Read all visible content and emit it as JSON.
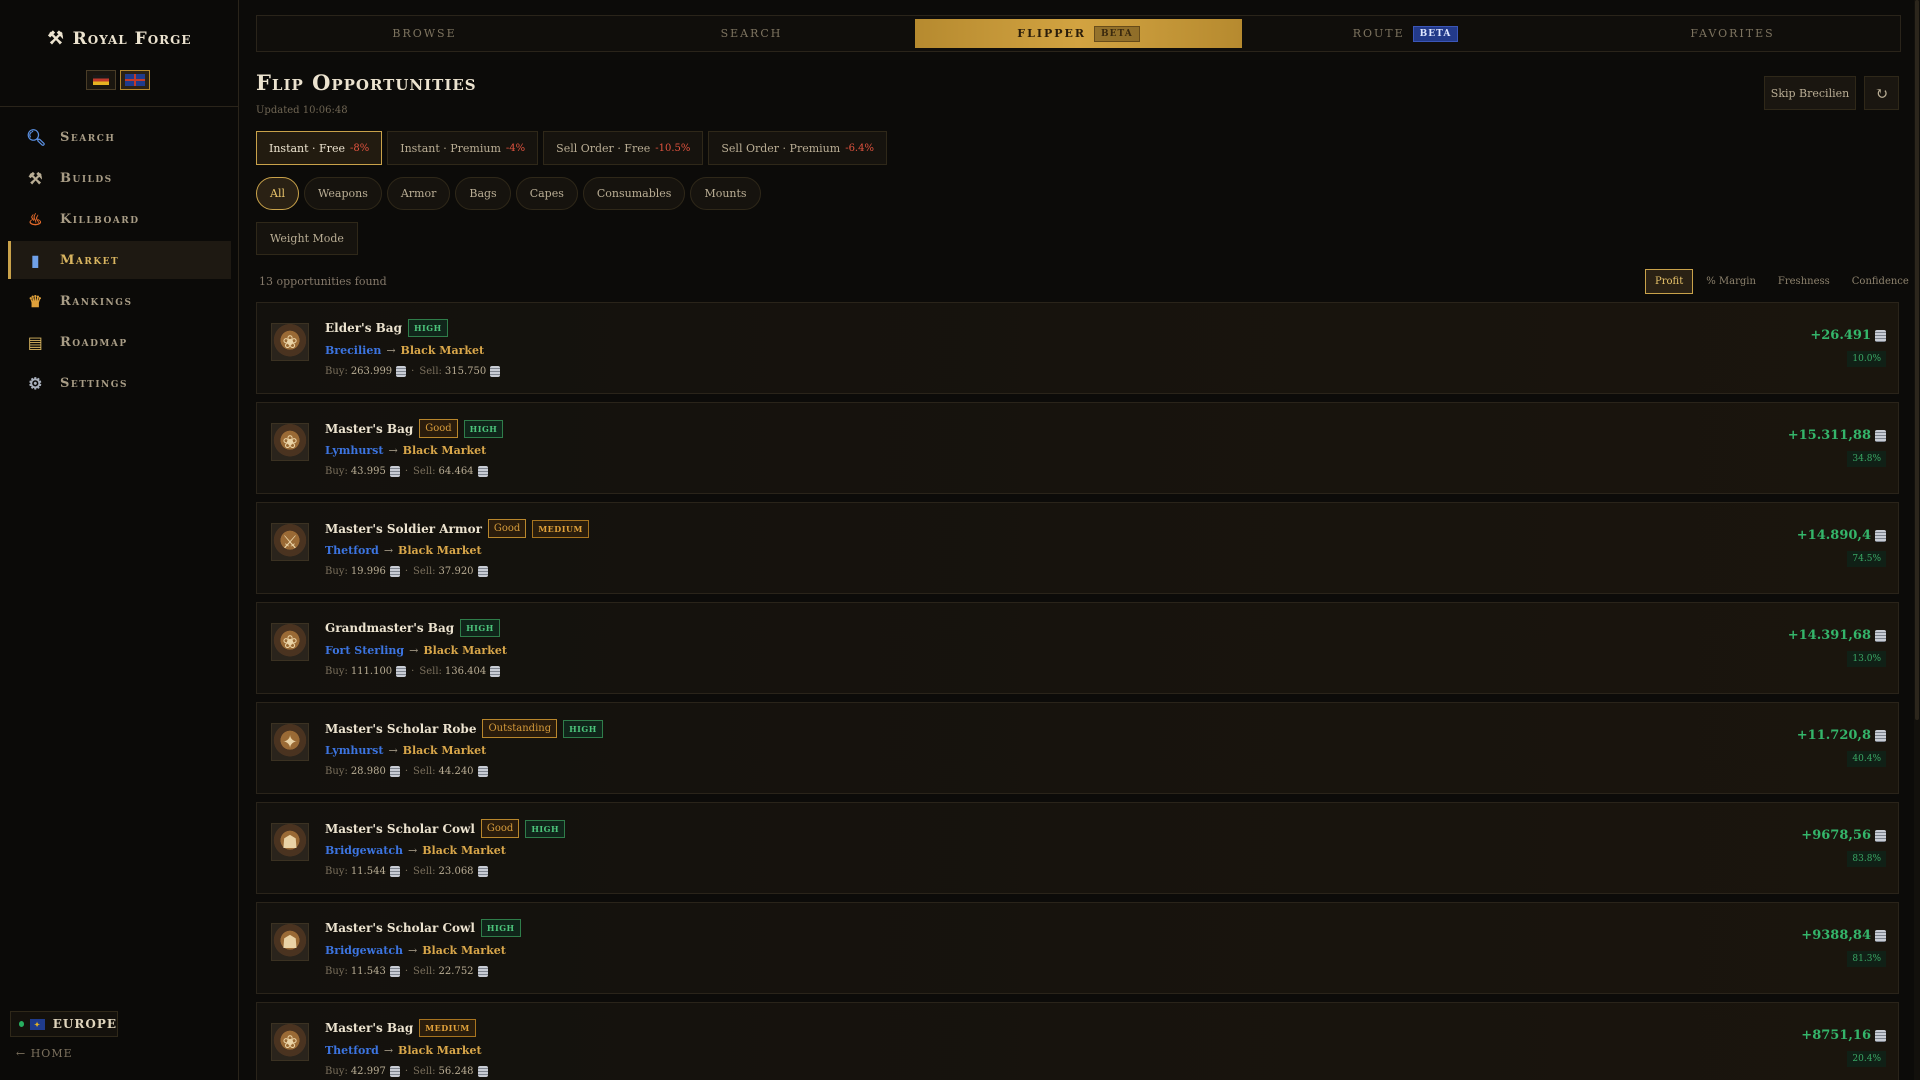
{
  "brand": {
    "name": "Royal Forge",
    "icon": "crossed-hammers-icon"
  },
  "nav": [
    {
      "label": "Search",
      "icon": "magnifier-icon"
    },
    {
      "label": "Builds",
      "icon": "hammer-icon"
    },
    {
      "label": "Killboard",
      "icon": "flame-icon"
    },
    {
      "label": "Market",
      "icon": "bar-chart-icon",
      "active": true
    },
    {
      "label": "Rankings",
      "icon": "trophy-icon"
    },
    {
      "label": "Roadmap",
      "icon": "scroll-icon"
    },
    {
      "label": "Settings",
      "icon": "gear-icon"
    }
  ],
  "region": {
    "label": "EUROPE"
  },
  "home_link": "← HOME",
  "tabs": [
    {
      "label": "BROWSE"
    },
    {
      "label": "SEARCH"
    },
    {
      "label": "FLIPPER",
      "badge": "BETA",
      "active": true
    },
    {
      "label": "ROUTE",
      "badge": "BETA"
    },
    {
      "label": "FAVORITES"
    }
  ],
  "page": {
    "title": "Flip Opportunities",
    "updated": "Updated 10:06:48",
    "skip_label": "Skip Brecilien",
    "refresh_icon": "refresh-icon"
  },
  "modes": [
    {
      "label": "Instant · Free",
      "pct": "-8%",
      "active": true
    },
    {
      "label": "Instant · Premium",
      "pct": "-4%"
    },
    {
      "label": "Sell Order · Free",
      "pct": "-10.5%"
    },
    {
      "label": "Sell Order · Premium",
      "pct": "-6.4%"
    }
  ],
  "categories": [
    "All",
    "Weapons",
    "Armor",
    "Bags",
    "Capes",
    "Consumables",
    "Mounts"
  ],
  "weight_mode": "Weight Mode",
  "result_count": "13 opportunities found",
  "sort_options": [
    {
      "label": "Profit",
      "active": true
    },
    {
      "label": "% Margin"
    },
    {
      "label": "Freshness"
    },
    {
      "label": "Confidence"
    }
  ],
  "buy_label": "Buy:",
  "sell_label": "Sell:",
  "route_arrow": "→",
  "price_sep": "·",
  "opportunities": [
    {
      "name": "Elder's Bag",
      "quality": "",
      "confidence": "HIGH",
      "from": "Brecilien",
      "to": "Black Market",
      "buy": "263.999",
      "sell": "315.750",
      "profit": "+26.491",
      "margin": "10.0%"
    },
    {
      "name": "Master's Bag",
      "quality": "Good",
      "confidence": "HIGH",
      "from": "Lymhurst",
      "to": "Black Market",
      "buy": "43.995",
      "sell": "64.464",
      "profit": "+15.311,88",
      "margin": "34.8%"
    },
    {
      "name": "Master's Soldier Armor",
      "quality": "Good",
      "confidence": "MEDIUM",
      "from": "Thetford",
      "to": "Black Market",
      "buy": "19.996",
      "sell": "37.920",
      "profit": "+14.890,4",
      "margin": "74.5%"
    },
    {
      "name": "Grandmaster's Bag",
      "quality": "",
      "confidence": "HIGH",
      "from": "Fort Sterling",
      "to": "Black Market",
      "buy": "111.100",
      "sell": "136.404",
      "profit": "+14.391,68",
      "margin": "13.0%"
    },
    {
      "name": "Master's Scholar Robe",
      "quality": "Outstanding",
      "confidence": "HIGH",
      "from": "Lymhurst",
      "to": "Black Market",
      "buy": "28.980",
      "sell": "44.240",
      "profit": "+11.720,8",
      "margin": "40.4%"
    },
    {
      "name": "Master's Scholar Cowl",
      "quality": "Good",
      "confidence": "HIGH",
      "from": "Bridgewatch",
      "to": "Black Market",
      "buy": "11.544",
      "sell": "23.068",
      "profit": "+9678,56",
      "margin": "83.8%"
    },
    {
      "name": "Master's Scholar Cowl",
      "quality": "",
      "confidence": "HIGH",
      "from": "Bridgewatch",
      "to": "Black Market",
      "buy": "11.543",
      "sell": "22.752",
      "profit": "+9388,84",
      "margin": "81.3%"
    },
    {
      "name": "Master's Bag",
      "quality": "",
      "confidence": "MEDIUM",
      "from": "Thetford",
      "to": "Black Market",
      "buy": "42.997",
      "sell": "56.248",
      "profit": "+8751,16",
      "margin": "20.4%"
    }
  ],
  "colors": {
    "accent_gold": "#c9a24a",
    "profit_green": "#34b56a",
    "city_blue": "#3c74e0",
    "tax_red": "#e0533f"
  }
}
